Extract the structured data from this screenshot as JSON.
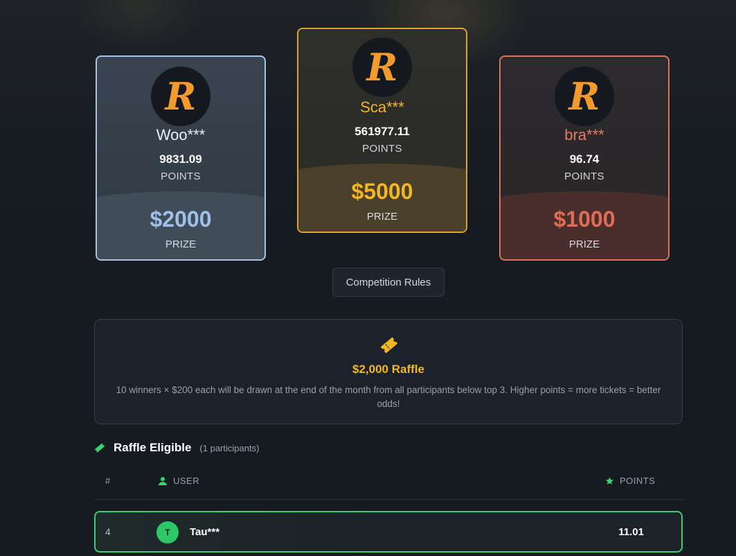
{
  "podium": {
    "second": {
      "username": "Woo***",
      "points": "9831.09",
      "points_label": "POINTS",
      "prize": "$2000",
      "prize_label": "PRIZE"
    },
    "first": {
      "username": "Sca***",
      "points": "561977.11",
      "points_label": "POINTS",
      "prize": "$5000",
      "prize_label": "PRIZE"
    },
    "third": {
      "username": "bra***",
      "points": "96.74",
      "points_label": "POINTS",
      "prize": "$1000",
      "prize_label": "PRIZE"
    },
    "avatar_letter": "R"
  },
  "rules_button": "Competition Rules",
  "raffle": {
    "icon": "ticket-icon",
    "title": "$2,000 Raffle",
    "description": "10 winners × $200 each will be drawn at the end of the month from all participants below top 3. Higher points = more tickets = better odds!"
  },
  "eligible": {
    "icon": "ticket-icon",
    "title": "Raffle Eligible",
    "count": "(1 participants)"
  },
  "table": {
    "headers": {
      "rank": "#",
      "user": "USER",
      "points": "POINTS"
    },
    "rows": [
      {
        "rank": "4",
        "initial": "T",
        "username": "Tau***",
        "points": "11.01"
      }
    ]
  },
  "colors": {
    "gold": "#f3b522",
    "silver": "#9fc0e8",
    "bronze": "#e06c56",
    "accent_green": "#3ecf6e",
    "logo_orange": "#f29a2e"
  }
}
